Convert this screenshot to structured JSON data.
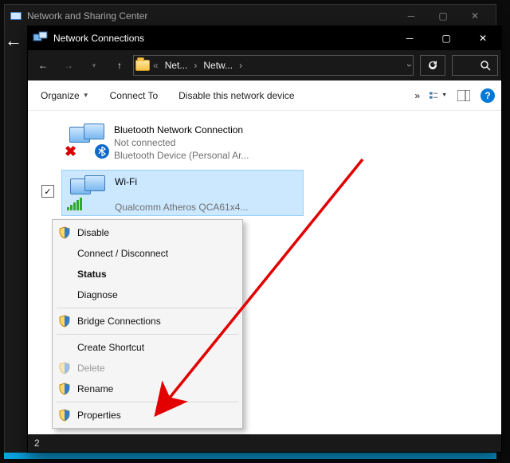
{
  "background_window": {
    "title": "Network and Sharing Center"
  },
  "window": {
    "title": "Network Connections"
  },
  "breadcrumbs": {
    "prefix": "«",
    "crumb1": "Net...",
    "crumb2": "Netw..."
  },
  "toolbar": {
    "organize": "Organize",
    "connect_to": "Connect To",
    "disable_device": "Disable this network device",
    "more": "»"
  },
  "adapters": {
    "bt": {
      "name": "Bluetooth Network Connection",
      "status": "Not connected",
      "device": "Bluetooth Device (Personal Ar..."
    },
    "wifi": {
      "name": "Wi-Fi",
      "ssid": "",
      "device": "Qualcomm Atheros QCA61x4...",
      "checked": true
    }
  },
  "context_menu": {
    "disable": "Disable",
    "connect_disconnect": "Connect / Disconnect",
    "status": "Status",
    "diagnose": "Diagnose",
    "bridge": "Bridge Connections",
    "create_shortcut": "Create Shortcut",
    "delete": "Delete",
    "rename": "Rename",
    "properties": "Properties"
  },
  "statusbar": {
    "count": "2"
  }
}
